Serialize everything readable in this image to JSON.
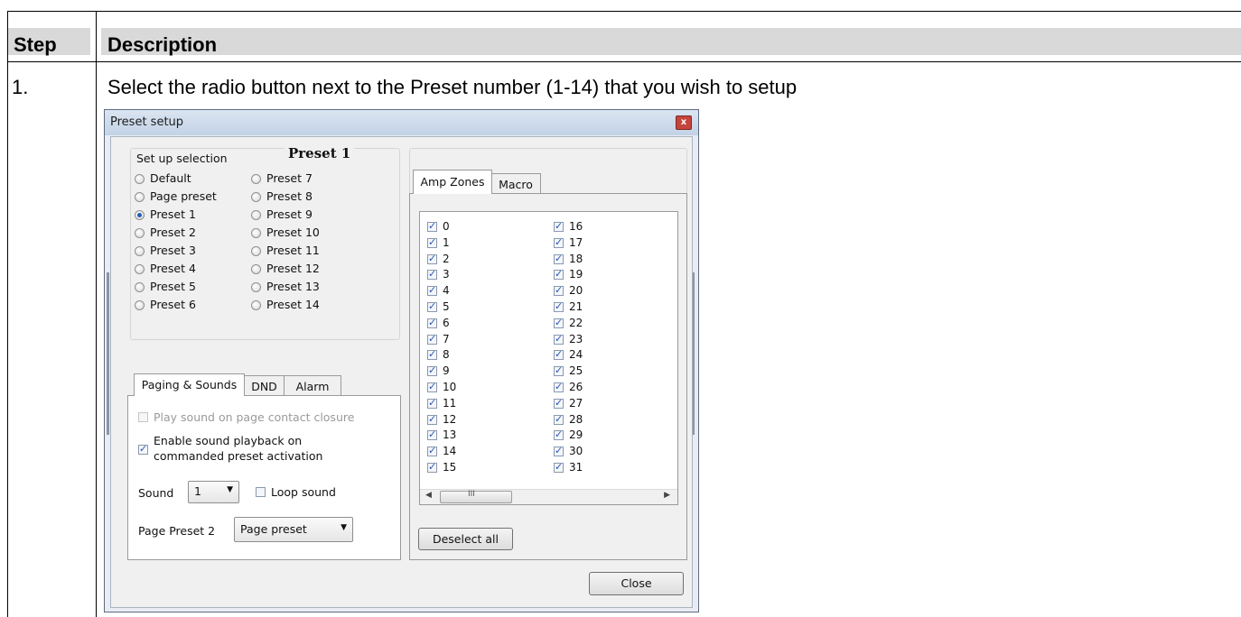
{
  "table": {
    "header_step": "Step",
    "header_description": "Description",
    "row_step": "1.",
    "row_description": "Select the radio button next to the Preset number (1-14) that you wish to setup"
  },
  "dialog": {
    "title": "Preset setup",
    "close_glyph": "x",
    "setup_selection_label": "Set up selection",
    "current_preset": "Preset 1",
    "radios_left": [
      "Default",
      "Page preset",
      "Preset 1",
      "Preset 2",
      "Preset 3",
      "Preset 4",
      "Preset 5",
      "Preset 6"
    ],
    "radios_right": [
      "Preset 7",
      "Preset 8",
      "Preset 9",
      "Preset 10",
      "Preset 11",
      "Preset 12",
      "Preset 13",
      "Preset 14"
    ],
    "selected_radio": "Preset 1",
    "lower_tabs": [
      "Paging & Sounds",
      "DND",
      "Alarm"
    ],
    "active_lower_tab": "Paging & Sounds",
    "play_sound_label": "Play sound on page contact closure",
    "play_sound_checked": false,
    "play_sound_enabled": false,
    "enable_playback_label_line1": "Enable sound playback on",
    "enable_playback_label_line2": "commanded preset activation",
    "enable_playback_checked": true,
    "sound_label": "Sound",
    "sound_value": "1",
    "loop_sound_label": "Loop sound",
    "loop_sound_checked": false,
    "page_preset_label": "Page Preset 2",
    "page_preset_value": "Page preset",
    "right_tabs": [
      "Amp Zones",
      "Macro"
    ],
    "active_right_tab": "Amp Zones",
    "zones_col1": [
      "0",
      "1",
      "2",
      "3",
      "4",
      "5",
      "6",
      "7",
      "8",
      "9",
      "10",
      "11",
      "12",
      "13",
      "14",
      "15"
    ],
    "zones_col2": [
      "16",
      "17",
      "18",
      "19",
      "20",
      "21",
      "22",
      "23",
      "24",
      "25",
      "26",
      "27",
      "28",
      "29",
      "30",
      "31"
    ],
    "zones_all_checked": true,
    "scroll_grip": "III",
    "deselect_all_label": "Deselect all",
    "close_button_label": "Close"
  },
  "icons": {
    "dropdown_arrow": "chevron-down-icon",
    "scroll_left": "scroll-left-icon",
    "scroll_right": "scroll-right-icon",
    "close": "close-icon"
  }
}
